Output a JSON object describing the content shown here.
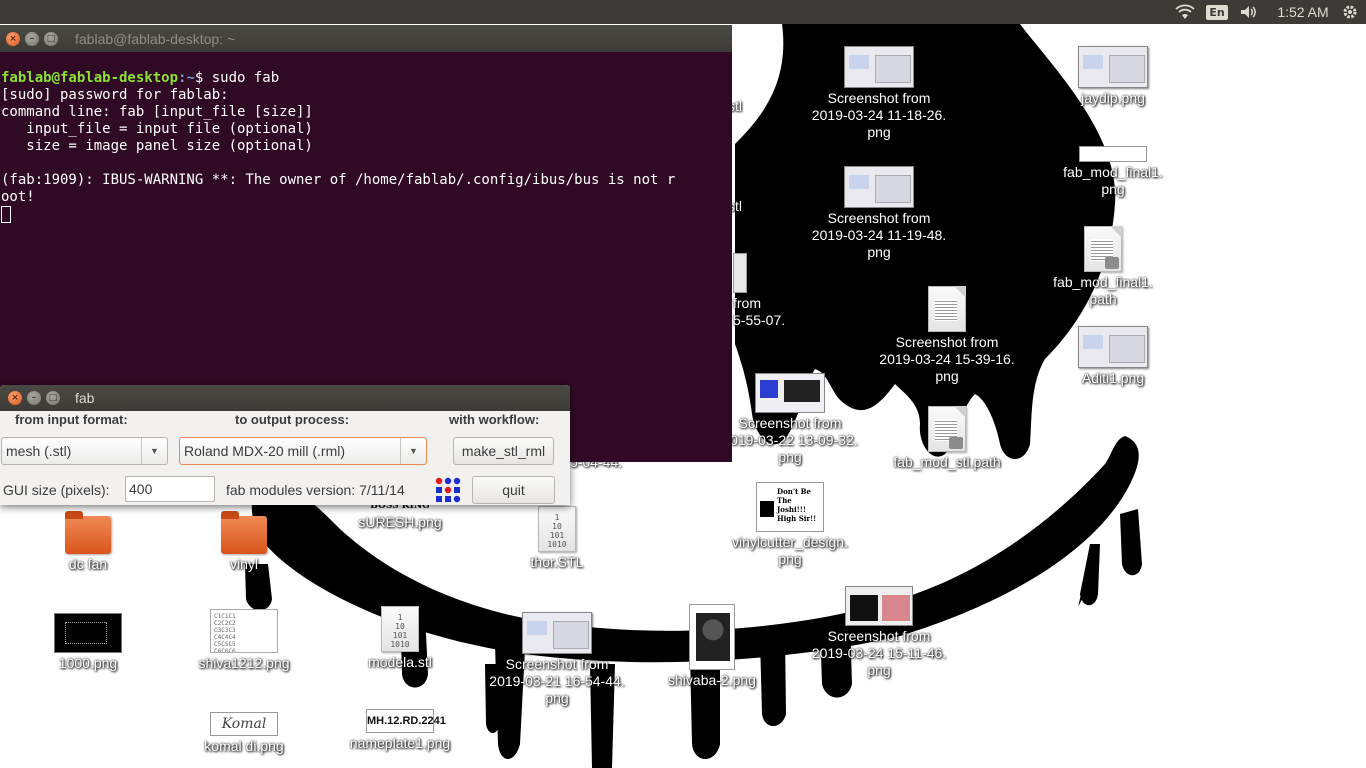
{
  "topbar": {
    "wifi_icon": "wifi-icon",
    "language": "En",
    "volume_icon": "volume-icon",
    "clock": "1:52 AM",
    "settings_icon": "gear-icon"
  },
  "desktop": {
    "items": [
      {
        "label": "Screenshot from\n2019-03-24 11-18-26.\npng",
        "kind": "shot"
      },
      {
        "label": "jaydip.png",
        "kind": "shot"
      },
      {
        "label": "Screenshot from\n2019-03-24 11-19-48.\npng",
        "kind": "shot"
      },
      {
        "label": "fab_mod_final1.\npng",
        "kind": "blank"
      },
      {
        "label": "fab_mod_final1.\npath",
        "kind": "doc"
      },
      {
        "label": "Screenshot from\n2019-03-24 15-39-16.\npng",
        "kind": "doc"
      },
      {
        "label": "Aditi1.png",
        "kind": "shot"
      },
      {
        "label": "Screenshot from\n2019-03-22 13-09-32.\npng",
        "kind": "moon"
      },
      {
        "label": "fab_mod_stl.path",
        "kind": "doc"
      },
      {
        "label": "vinylcutter_design.\npng",
        "kind": "cutter"
      },
      {
        "label": "Screenshot from\n2019-03-24 15-11-46.\npng",
        "kind": "red"
      },
      {
        "label": "dc fan",
        "kind": "folder"
      },
      {
        "label": "vinyl",
        "kind": "folder"
      },
      {
        "label": "sURESH.png",
        "kind": "none"
      },
      {
        "label": "thor.STL",
        "kind": "bin"
      },
      {
        "label": "1000.png",
        "kind": "dark"
      },
      {
        "label": "shiva1212.png",
        "kind": "grid"
      },
      {
        "label": "modela.stl",
        "kind": "bin"
      },
      {
        "label": "Screenshot from\n2019-03-21 16-54-44.\npng",
        "kind": "shot"
      },
      {
        "label": "shivaba-2.png",
        "kind": "portrait"
      },
      {
        "label": "komal di.png",
        "kind": "label"
      },
      {
        "label": "nameplate1.png",
        "kind": "plate"
      }
    ],
    "partial": {
      "stl_a": "stl",
      "stl_b": "stl",
      "from": "from",
      "date_frag": "5-55-07.",
      "date_frag2": "5-04-44.",
      "suresh_banner": "BOSS KING"
    },
    "thumb_text": {
      "bin": "1\n10\n101\n1010",
      "grid": "C1C1C1\nC2C2C2\nC3C3C3\nC4C4C4\nC5C5C5\nC6C6C6",
      "komal": "Komal",
      "plate": "MH.12.RD.2241",
      "cutter": "Don't Be The Joshi!!! High Sir!!"
    }
  },
  "terminal": {
    "title": "fablab@fablab-desktop: ~",
    "prompt_user": "fablab@fablab-desktop",
    "prompt_path": ":~",
    "command": "$ sudo fab",
    "lines": [
      "[sudo] password for fablab:",
      "command line: fab [input_file [size]]",
      "   input_file = input file (optional)",
      "   size = image panel size (optional)",
      "",
      "(fab:1909): IBUS-WARNING **: The owner of /home/fablab/.config/ibus/bus is not r",
      "oot!"
    ]
  },
  "fab": {
    "title": "fab",
    "input_header": "from input format:",
    "output_header": "to output process:",
    "workflow_header": "with workflow:",
    "input_value": "mesh (.stl)",
    "output_value": "Roland MDX-20 mill (.rml)",
    "workflow_button": "make_stl_rml",
    "gui_size_label": "GUI size (pixels):",
    "gui_size_value": "400",
    "version": "fab modules version: 7/11/14",
    "logo_icon": "fab-logo-icon",
    "quit": "quit"
  },
  "colors": {
    "terminal_bg": "#300a24",
    "prompt_user": "#8ae234",
    "prompt_path": "#729fcf",
    "panel": "#3c3b37",
    "close_button": "#e05620"
  }
}
